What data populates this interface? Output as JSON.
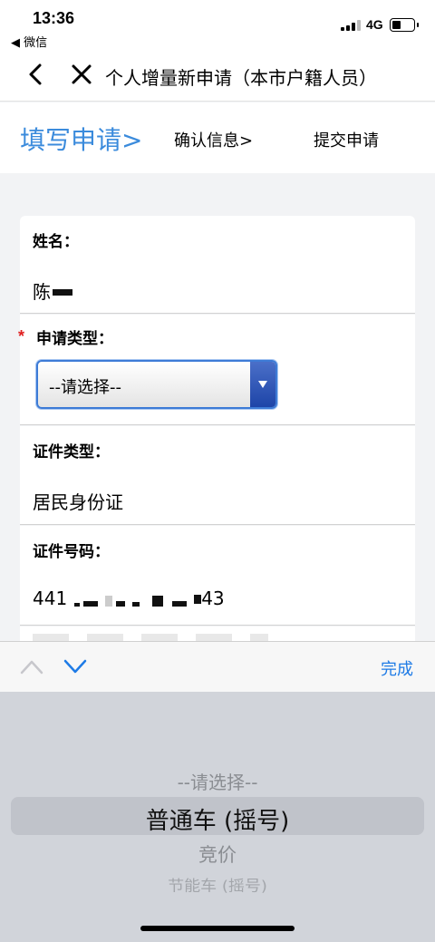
{
  "status_bar": {
    "time": "13:36",
    "back_app": "◀ 微信",
    "network": "4G",
    "battery_level": 0.4
  },
  "nav": {
    "title": "个人增量新申请（本市户籍人员）"
  },
  "steps": {
    "step1": "填写申请>",
    "step2": "确认信息>",
    "step3": "提交申请",
    "active_color": "#3b8bdc"
  },
  "form": {
    "name": {
      "label": "姓名：",
      "value": "陈"
    },
    "apply_type": {
      "required_mark": "*",
      "label": "申请类型：",
      "selected": "--请选择--"
    },
    "id_type": {
      "label": "证件类型：",
      "value": "居民身份证"
    },
    "id_number": {
      "label": "证件号码：",
      "prefix": "441",
      "suffix": "43"
    }
  },
  "accessory": {
    "done_label": "完成",
    "done_color": "#1e7be6"
  },
  "picker": {
    "options": [
      "--请选择--",
      "普通车 (摇号)",
      "竞价",
      "节能车 (摇号)"
    ],
    "highlighted_index": 1
  }
}
